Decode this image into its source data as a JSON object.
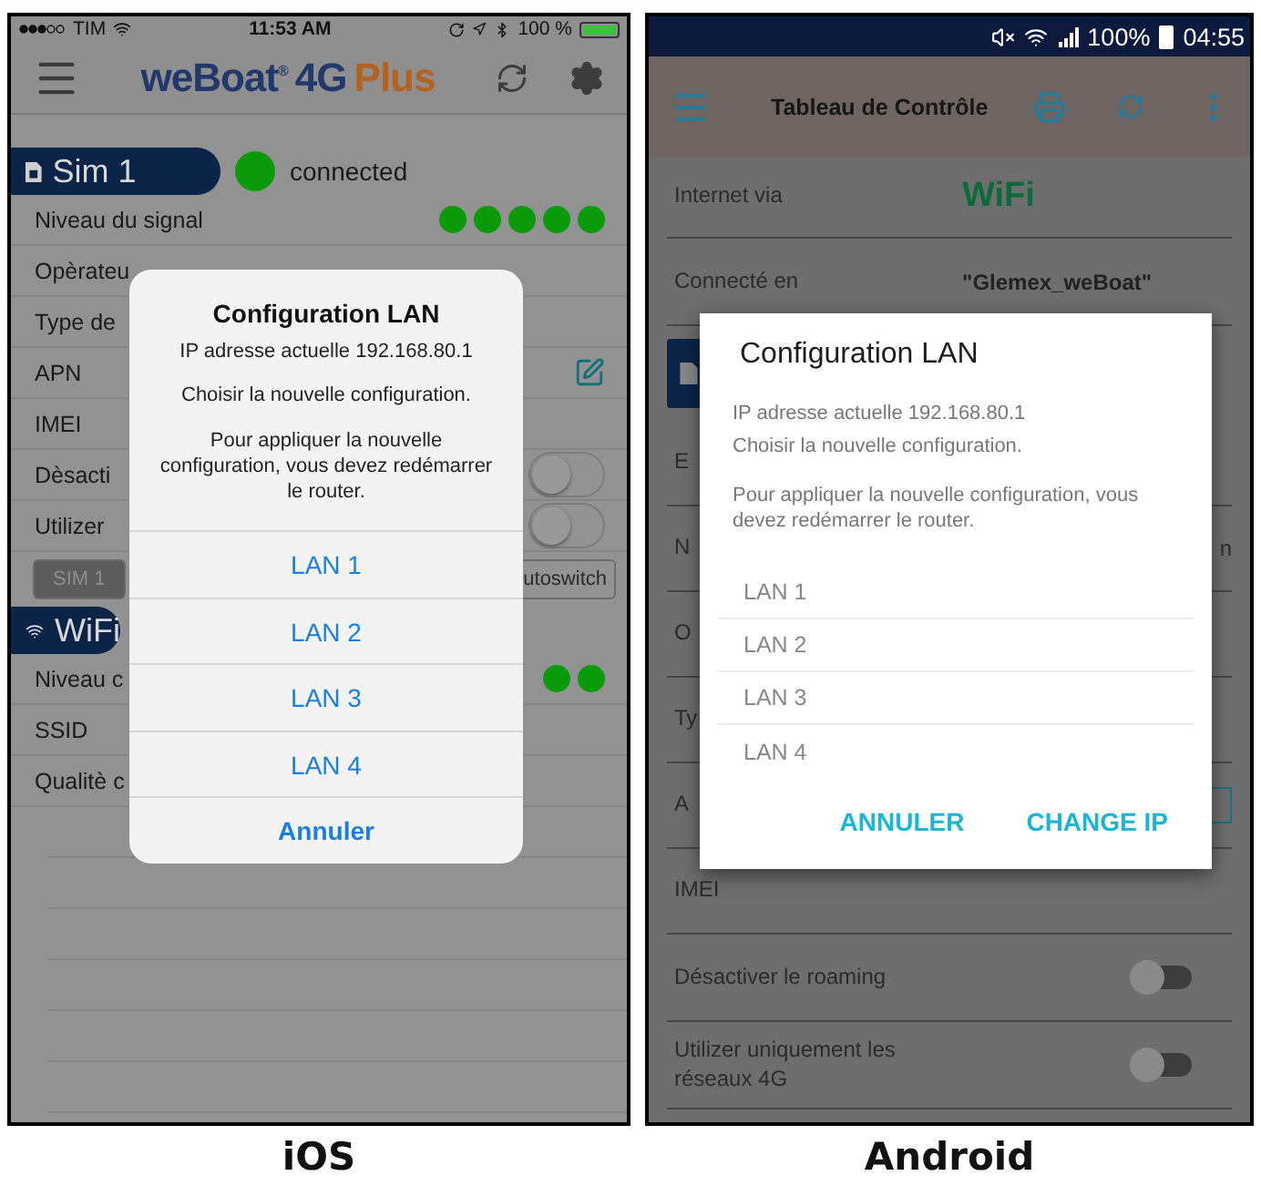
{
  "ios_screen": {
    "caption": "iOS",
    "status_bar": {
      "carrier": "TIM",
      "time": "11:53 AM",
      "battery": "100 %"
    },
    "app_bar": {
      "brand": "weBoat$^{®}$",
      "model": "4G",
      "edition": "Plus"
    },
    "sim_section": {
      "title": "Sim 1",
      "status": "connected",
      "connected": true
    },
    "sim_rows": [
      {
        "kind": "signal",
        "label": "Niveau du signal",
        "stars": 5
      },
      {
        "kind": "text",
        "label": "Opèrateu"
      },
      {
        "kind": "text",
        "label": "Type de"
      },
      {
        "kind": "edit",
        "label": "APN"
      },
      {
        "kind": "text",
        "label": "IMEI"
      },
      {
        "kind": "toggle",
        "label": "Dèsacti",
        "on": false
      },
      {
        "kind": "toggle",
        "label": "Utilizer",
        "on": false
      }
    ],
    "mode_buttons": [
      {
        "label": "SIM 1",
        "selected": true
      },
      {
        "label": "utoswitch",
        "selected": false
      }
    ],
    "wifi_section": {
      "title": "WiFi"
    },
    "wifi_rows": [
      {
        "kind": "signal_drawing",
        "label": "Niveau c"
      },
      {
        "kind": "text",
        "label": "SSID"
      },
      {
        "kind": "text",
        "label": "Qualitè c"
      }
    ],
    "dialog": {
      "title": "Configuration LAN",
      "messages": [
        "IP adresse actuelle 192.168.80.1",
        "Choisir la nouvelle configuration.",
        "Pour appliquer la nouvelle configuration, vous devez redémarrer le router."
      ],
      "options": [
        "LAN 1",
        "LAN 2",
        "LAN 3",
        "LAN 4"
      ],
      "cancel": "Annuler"
    }
  },
  "android_screen": {
    "caption": "Android",
    "status_bar": {
      "battery": "100%",
      "time": "04:55"
    },
    "toolbar": {
      "title": "Tableau de Contrôle"
    },
    "internet": {
      "label": "Internet via",
      "value": "WiFi"
    },
    "connection": {
      "label": "Connecté en",
      "value": "\"Glemex_weBoat\""
    },
    "rows": [
      {
        "kind": "text",
        "label": "E"
      },
      {
        "kind": "text",
        "label": "N",
        "value": "n"
      },
      {
        "kind": "text",
        "label": "O"
      },
      {
        "kind": "text",
        "label": "Ty"
      },
      {
        "kind": "field",
        "label": "A"
      },
      {
        "kind": "text",
        "label": "IMEI"
      },
      {
        "kind": "toggle",
        "label": "Désactiver le roaming",
        "on": false
      },
      {
        "kind": "toggle",
        "label": "Utilizer uniquement les réseaux 4G",
        "on": false
      }
    ],
    "dialog": {
      "title": "Configuration LAN",
      "messages": [
        "IP adresse actuelle 192.168.80.1",
        "Choisir la nouvelle configuration.",
        "Pour appliquer la nouvelle configuration, vous devez redémarrer le router."
      ],
      "options": [
        "LAN 1",
        "LAN 2",
        "LAN 3",
        "LAN 4"
      ],
      "actions": [
        "ANNULER",
        "CHANGE IP"
      ]
    }
  }
}
